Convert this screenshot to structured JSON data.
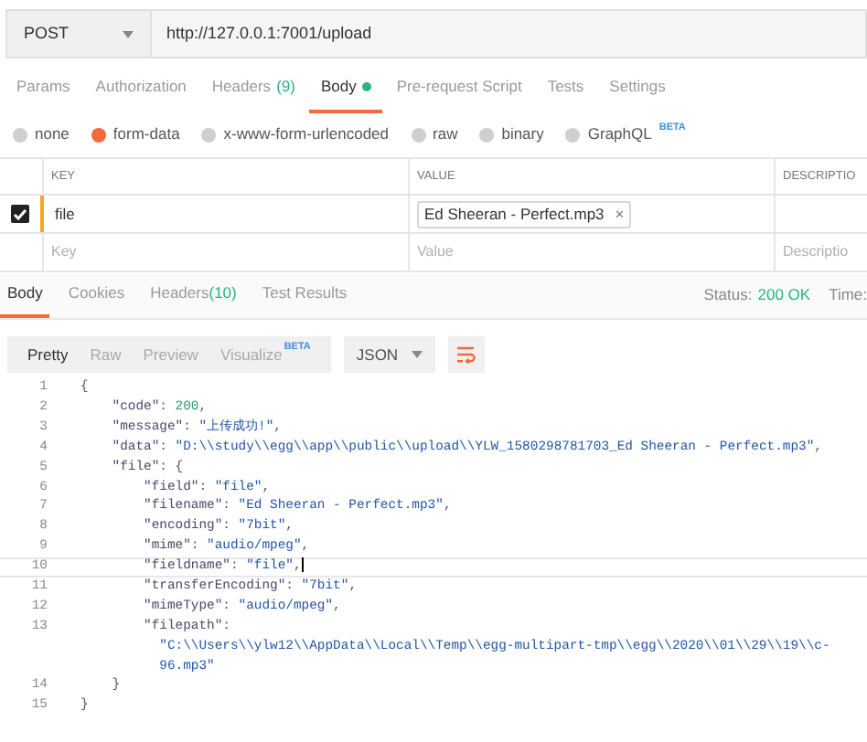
{
  "request": {
    "method": "POST",
    "url": "http://127.0.0.1:7001/upload"
  },
  "request_tabs": [
    {
      "label": "Params",
      "dot": false,
      "selected": false
    },
    {
      "label": "Authorization",
      "dot": false,
      "selected": false
    },
    {
      "label": "Headers",
      "count": "(9)",
      "dot": false,
      "selected": false
    },
    {
      "label": "Body",
      "dot": true,
      "selected": true
    },
    {
      "label": "Pre-request Script",
      "dot": false,
      "selected": false
    },
    {
      "label": "Tests",
      "dot": false,
      "selected": false
    },
    {
      "label": "Settings",
      "dot": false,
      "selected": false
    }
  ],
  "body_types": [
    {
      "label": "none",
      "selected": false
    },
    {
      "label": "form-data",
      "selected": true
    },
    {
      "label": "x-www-form-urlencoded",
      "selected": false
    },
    {
      "label": "raw",
      "selected": false
    },
    {
      "label": "binary",
      "selected": false
    },
    {
      "label": "GraphQL",
      "badge": "BETA",
      "selected": false
    }
  ],
  "form_table": {
    "columns": [
      "KEY",
      "VALUE",
      "DESCRIPTIO"
    ],
    "rows": [
      {
        "checked": true,
        "key": "file",
        "file": "Ed Sheeran - Perfect.mp3",
        "remove": "×"
      }
    ],
    "new_row": {
      "key_placeholder": "Key",
      "value_placeholder": "Value",
      "description_placeholder": "Descriptio"
    }
  },
  "response_tabs": [
    {
      "label": "Body",
      "selected": true
    },
    {
      "label": "Cookies",
      "selected": false
    },
    {
      "label": "Headers",
      "count": "(10)",
      "selected": false
    },
    {
      "label": "Test Results",
      "selected": false
    }
  ],
  "status": {
    "label": "Status:",
    "value": "200 OK",
    "time_label": "Time:"
  },
  "view_modes": [
    {
      "label": "Pretty",
      "selected": true
    },
    {
      "label": "Raw",
      "selected": false
    },
    {
      "label": "Preview",
      "selected": false
    },
    {
      "label": "Visualize",
      "badge": "BETA",
      "selected": false
    }
  ],
  "format": "JSON",
  "code_lines": [
    {
      "number": "1",
      "current": false,
      "tokens": [
        {
          "kind": "punct",
          "text": "{"
        }
      ]
    },
    {
      "number": "2",
      "current": false,
      "tokens": [
        {
          "kind": "key",
          "text": "    \"code\""
        },
        {
          "kind": "punct",
          "text": ": "
        },
        {
          "kind": "number",
          "text": "200"
        },
        {
          "kind": "punct",
          "text": ","
        }
      ]
    },
    {
      "number": "3",
      "current": false,
      "tokens": [
        {
          "kind": "key",
          "text": "    \"message\""
        },
        {
          "kind": "punct",
          "text": ": "
        },
        {
          "kind": "string",
          "text": "\"上传成功!\""
        },
        {
          "kind": "punct",
          "text": ","
        }
      ]
    },
    {
      "number": "4",
      "current": false,
      "tokens": [
        {
          "kind": "key",
          "text": "    \"data\""
        },
        {
          "kind": "punct",
          "text": ": "
        },
        {
          "kind": "string",
          "text": "\"D:\\\\study\\\\egg\\\\app\\\\public\\\\upload\\\\YLW_1580298781703_Ed Sheeran - Perfect.mp3\""
        },
        {
          "kind": "punct",
          "text": ","
        }
      ]
    },
    {
      "number": "5",
      "current": false,
      "tokens": [
        {
          "kind": "key",
          "text": "    \"file\""
        },
        {
          "kind": "punct",
          "text": ": {"
        }
      ]
    },
    {
      "number": "6",
      "current": false,
      "tokens": [
        {
          "kind": "key",
          "text": "        \"field\""
        },
        {
          "kind": "punct",
          "text": ": "
        },
        {
          "kind": "string",
          "text": "\"file\""
        },
        {
          "kind": "punct",
          "text": ","
        }
      ]
    },
    {
      "number": "7",
      "current": false,
      "tokens": [
        {
          "kind": "key",
          "text": "        \"filename\""
        },
        {
          "kind": "punct",
          "text": ": "
        },
        {
          "kind": "string",
          "text": "\"Ed Sheeran - Perfect.mp3\""
        },
        {
          "kind": "punct",
          "text": ","
        }
      ]
    },
    {
      "number": "8",
      "current": false,
      "tokens": [
        {
          "kind": "key",
          "text": "        \"encoding\""
        },
        {
          "kind": "punct",
          "text": ": "
        },
        {
          "kind": "string",
          "text": "\"7bit\""
        },
        {
          "kind": "punct",
          "text": ","
        }
      ]
    },
    {
      "number": "9",
      "current": false,
      "tokens": [
        {
          "kind": "key",
          "text": "        \"mime\""
        },
        {
          "kind": "punct",
          "text": ": "
        },
        {
          "kind": "string",
          "text": "\"audio/mpeg\""
        },
        {
          "kind": "punct",
          "text": ","
        }
      ]
    },
    {
      "number": "10",
      "current": true,
      "tokens": [
        {
          "kind": "key",
          "text": "        \"fieldname\""
        },
        {
          "kind": "punct",
          "text": ": "
        },
        {
          "kind": "string",
          "text": "\"file\""
        },
        {
          "kind": "punct",
          "text": ","
        }
      ]
    },
    {
      "number": "11",
      "current": false,
      "tokens": [
        {
          "kind": "key",
          "text": "        \"transferEncoding\""
        },
        {
          "kind": "punct",
          "text": ": "
        },
        {
          "kind": "string",
          "text": "\"7bit\""
        },
        {
          "kind": "punct",
          "text": ","
        }
      ]
    },
    {
      "number": "12",
      "current": false,
      "tokens": [
        {
          "kind": "key",
          "text": "        \"mimeType\""
        },
        {
          "kind": "punct",
          "text": ": "
        },
        {
          "kind": "string",
          "text": "\"audio/mpeg\""
        },
        {
          "kind": "punct",
          "text": ","
        }
      ]
    },
    {
      "number": "13",
      "current": false,
      "wrap": [
        "          \"C:\\\\Users\\\\ylw12\\\\AppData\\\\Local\\\\Temp\\\\egg-multipart-tmp\\\\egg\\\\2020\\\\01\\\\29\\\\19\\\\c-",
        "          96.mp3\""
      ],
      "tokens": [
        {
          "kind": "key",
          "text": "        \"filepath\""
        },
        {
          "kind": "punct",
          "text": ":"
        }
      ]
    },
    {
      "number": "14",
      "current": false,
      "tokens": [
        {
          "kind": "punct",
          "text": "    }"
        }
      ]
    },
    {
      "number": "15",
      "current": false,
      "tokens": [
        {
          "kind": "punct",
          "text": "}"
        }
      ]
    }
  ]
}
